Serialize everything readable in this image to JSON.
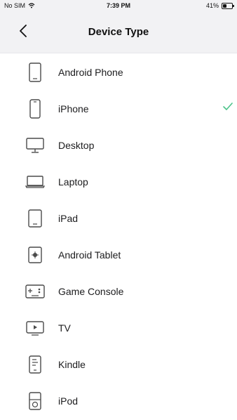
{
  "status_bar": {
    "carrier": "No SIM",
    "time": "7:39 PM",
    "battery_text": "41%",
    "battery_level": 0.41
  },
  "header": {
    "title": "Device Type",
    "back_icon": "chevron-left-icon"
  },
  "devices": [
    {
      "label": "Android Phone",
      "icon": "android-phone-icon",
      "selected": false
    },
    {
      "label": "iPhone",
      "icon": "iphone-icon",
      "selected": true
    },
    {
      "label": "Desktop",
      "icon": "desktop-icon",
      "selected": false
    },
    {
      "label": "Laptop",
      "icon": "laptop-icon",
      "selected": false
    },
    {
      "label": "iPad",
      "icon": "ipad-icon",
      "selected": false
    },
    {
      "label": "Android Tablet",
      "icon": "android-tablet-icon",
      "selected": false
    },
    {
      "label": "Game Console",
      "icon": "game-console-icon",
      "selected": false
    },
    {
      "label": "TV",
      "icon": "tv-icon",
      "selected": false
    },
    {
      "label": "Kindle",
      "icon": "kindle-icon",
      "selected": false
    },
    {
      "label": "iPod",
      "icon": "ipod-icon",
      "selected": false
    }
  ],
  "colors": {
    "accent_check": "#4cc38a",
    "icon_stroke": "#4a4a4a"
  }
}
